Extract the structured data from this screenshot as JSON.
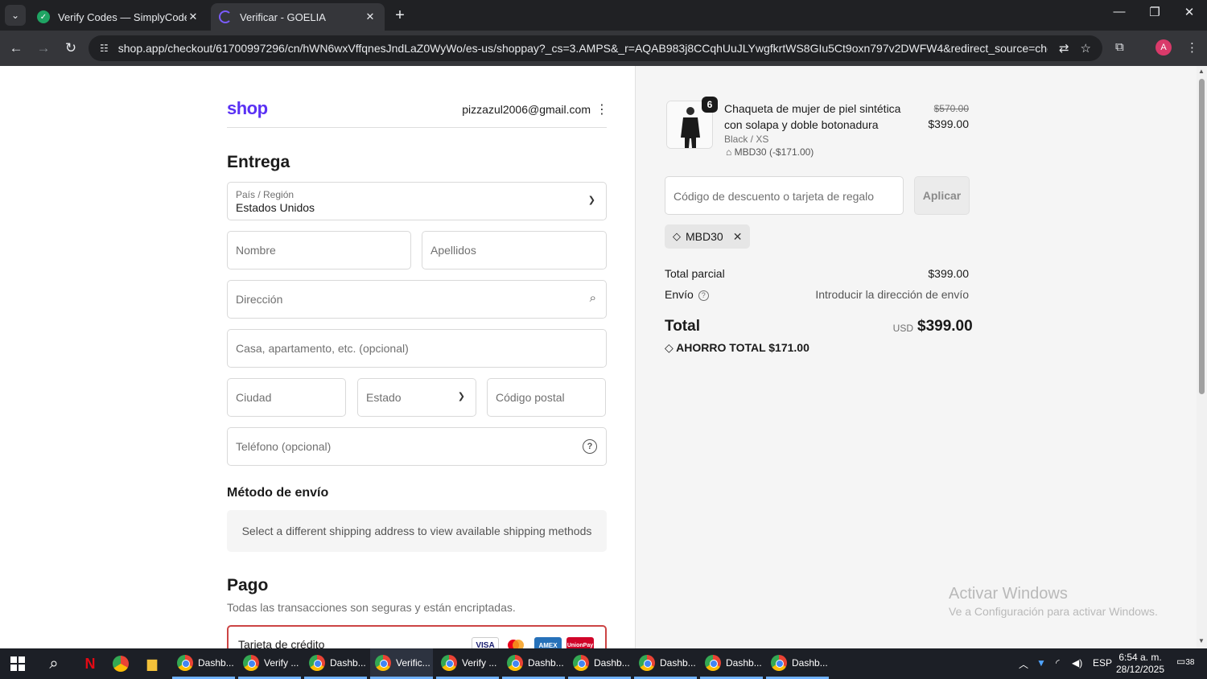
{
  "browser": {
    "tabs": [
      {
        "title": "Verify Codes — SimplyCodes",
        "active": false
      },
      {
        "title": "Verificar - GOELIA",
        "active": true
      }
    ],
    "url": "shop.app/checkout/61700997296/cn/hWN6wxVffqnesJndLaZ0WyWo/es-us/shoppay?_cs=3.AMPS&_r=AQAB983j8CCqhUuJLYwgfkrtWS8GIu5Ct9oxn797v2DWFW4&redirect_source=checkout_autom...",
    "profile_initial": "A"
  },
  "checkout": {
    "logo": "shop",
    "email": "pizzazul2006@gmail.com",
    "delivery_title": "Entrega",
    "country_label": "País / Región",
    "country_value": "Estados Unidos",
    "first_name_ph": "Nombre",
    "last_name_ph": "Apellidos",
    "address_ph": "Dirección",
    "apartment_ph": "Casa, apartamento, etc. (opcional)",
    "city_ph": "Ciudad",
    "state_ph": "Estado",
    "zip_ph": "Código postal",
    "phone_ph": "Teléfono (opcional)",
    "shipping_title": "Método de envío",
    "shipping_msg": "Select a different shipping address to view available shipping methods",
    "payment_title": "Pago",
    "payment_sub": "Todas las transacciones son seguras y están encriptadas.",
    "card_label": "Tarjeta de crédito",
    "card_logos": [
      "VISA",
      "MC",
      "AMEX",
      "UnionPay"
    ]
  },
  "summary": {
    "qty": "6",
    "product_name": "Chaqueta de mujer de piel sintética con solapa y doble botonadura",
    "variant": "Black / XS",
    "discount_line": "MBD30 (-$171.00)",
    "price_old": "$570.00",
    "price_new": "$399.00",
    "discount_ph": "Código de descuento o tarjeta de regalo",
    "apply_label": "Aplicar",
    "applied_code": "MBD30",
    "subtotal_label": "Total parcial",
    "subtotal_value": "$399.00",
    "shipping_label": "Envío",
    "shipping_value": "Introducir la dirección de envío",
    "total_label": "Total",
    "currency": "USD",
    "total_value": "$399.00",
    "savings": "AHORRO TOTAL  $171.00"
  },
  "watermark": {
    "line1": "Activar Windows",
    "line2": "Ve a Configuración para activar Windows."
  },
  "taskbar": {
    "apps": [
      "Dashb...",
      "Verify ...",
      "Dashb...",
      "Verific...",
      "Verify ...",
      "Dashb...",
      "Dashb...",
      "Dashb...",
      "Dashb...",
      "Dashb..."
    ],
    "lang": "ESP",
    "time": "6:54 a. m.",
    "date": "28/12/2025",
    "notif_count": "38"
  }
}
